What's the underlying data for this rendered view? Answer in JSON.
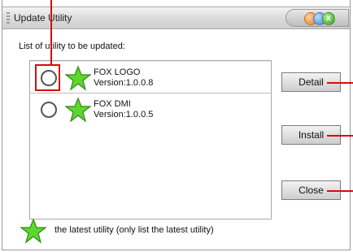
{
  "window": {
    "title": "Update Utility",
    "close_label": "x"
  },
  "header": {
    "subtitle": "List of utility to be updated:"
  },
  "utilities": [
    {
      "name": "FOX LOGO",
      "version": "Version:1.0.0.8",
      "selected": false
    },
    {
      "name": "FOX DMI",
      "version": "Version:1.0.0.5",
      "selected": false
    }
  ],
  "buttons": {
    "detail": "Detail",
    "install": "Install",
    "close": "Close"
  },
  "legend": {
    "text": "the latest utility (only list the latest utility)"
  },
  "icons": {
    "latest": "green-star-icon",
    "window_controls": [
      "orange-dot-icon",
      "blue-dot-icon",
      "green-close-icon"
    ]
  },
  "colors": {
    "highlight": "#d10f0f",
    "star_fill": "#5ed62f",
    "star_stroke": "#2f8a14"
  }
}
